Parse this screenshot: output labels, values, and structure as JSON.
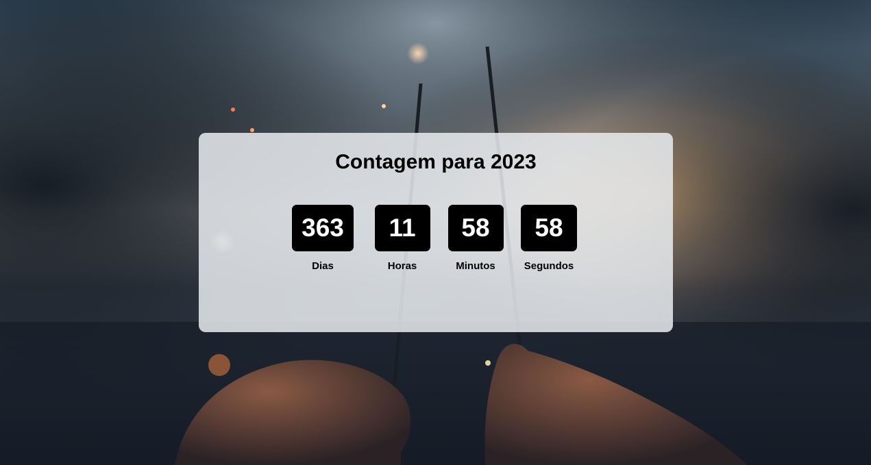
{
  "countdown": {
    "title": "Contagem para 2023",
    "units": [
      {
        "value": "363",
        "label": "Dias"
      },
      {
        "value": "11",
        "label": "Horas"
      },
      {
        "value": "58",
        "label": "Minutos"
      },
      {
        "value": "58",
        "label": "Segundos"
      }
    ]
  },
  "colors": {
    "card_background": "#e8ebef",
    "box_background": "#000000",
    "box_text": "#ffffff",
    "page_background": "#141c28"
  }
}
